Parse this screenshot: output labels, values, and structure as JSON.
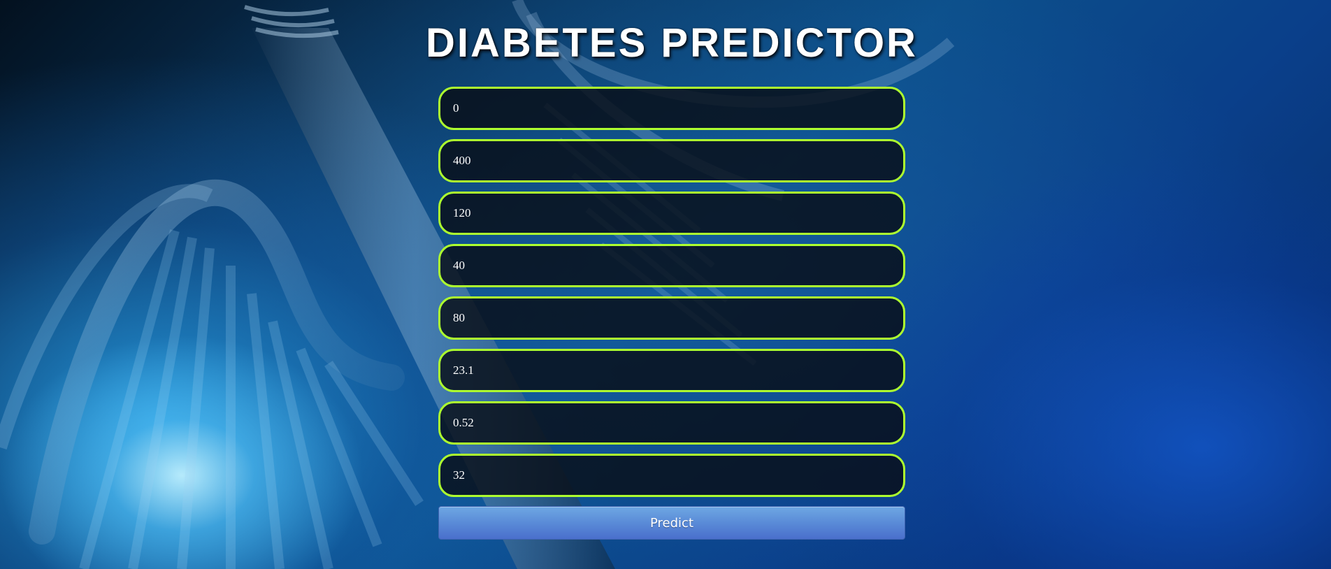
{
  "page": {
    "title": "DIABETES PREDICTOR"
  },
  "form": {
    "fields": [
      {
        "name": "pregnancies",
        "value": "0"
      },
      {
        "name": "glucose",
        "value": "400"
      },
      {
        "name": "blood-pressure",
        "value": "120"
      },
      {
        "name": "skin-thickness",
        "value": "40"
      },
      {
        "name": "insulin",
        "value": "80"
      },
      {
        "name": "bmi",
        "value": "23.1"
      },
      {
        "name": "diabetes-pedigree-function",
        "value": "0.52"
      },
      {
        "name": "age",
        "value": "32"
      }
    ],
    "submit_label": "Predict"
  },
  "colors": {
    "field_border": "#adff2f",
    "field_background": "#080e16",
    "button_top": "#6ea7e3",
    "button_bottom": "#4a6fcc",
    "background_dark": "#03111f",
    "background_accent": "#0c4f8a"
  }
}
